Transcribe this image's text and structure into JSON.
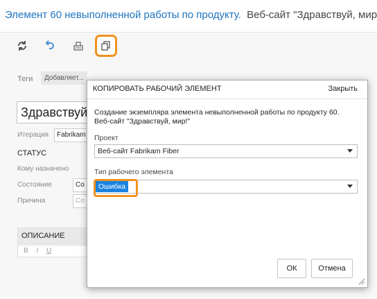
{
  "title": {
    "main": "Элемент 60 невыполненной работы по продукту.",
    "product": "Веб-сайт \"Здравствуй, мир!\""
  },
  "toolbar": {
    "icons": [
      "refresh-icon",
      "undo-icon",
      "attachment-icon",
      "copy-icon"
    ]
  },
  "form": {
    "tags_label": "Теги",
    "tags_add": "Добавляет...",
    "item_title": "Здравствуй, мир!",
    "iteration_label": "Итерация",
    "iteration_value": "Fabrikam",
    "status_header": "СТАТУС",
    "assigned_label": "Кому назначено",
    "state_label": "Состояние",
    "state_value": "Со",
    "reason_label": "Причина",
    "reason_value": "Co",
    "description_header": "ОПИСАНИЕ",
    "editor": [
      "B",
      "I",
      "U"
    ]
  },
  "dialog": {
    "title": "КОПИРОВАТЬ РАБОЧИЙ ЭЛЕМЕНТ",
    "close": "Закрыть",
    "message_line1": "Создание экземпляра элемента невыполненной работы по продукту 60.",
    "message_line2": "Веб-сайт \"Здравствуй, мир!\"",
    "project_label": "Проект",
    "project_value": "Веб-сайт Fabrikam Fiber",
    "type_label": "Тип рабочего элемента",
    "type_value": "Ошибка",
    "ok": "ОК",
    "cancel": "Отмена"
  },
  "colors": {
    "accent": "#1e73be",
    "highlight": "#f0921e",
    "selection": "#1a82e0"
  }
}
